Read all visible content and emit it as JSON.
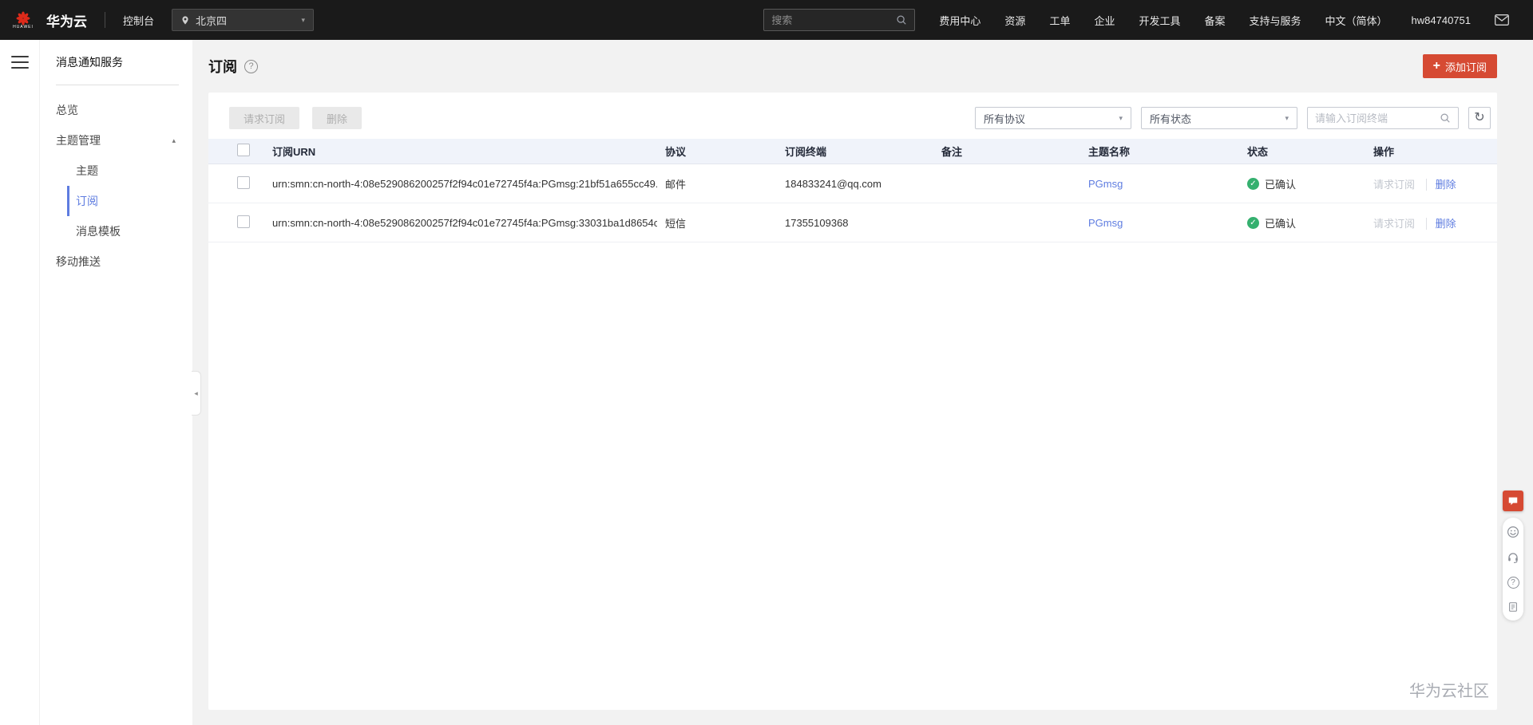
{
  "colors": {
    "accent": "#d64a33",
    "link": "#5e7ce0",
    "success": "#35b06f",
    "topbar_bg": "#1a1a1a"
  },
  "icons": {
    "help": "?",
    "refresh": "↻",
    "caret_down": "▾",
    "caret_up": "▴",
    "collapse": "◂",
    "check": "✓",
    "plus": "+"
  },
  "topbar": {
    "logo_text": "HUAWEI",
    "brand": "华为云",
    "console": "控制台",
    "region": "北京四",
    "search_placeholder": "搜索",
    "nav": [
      "费用中心",
      "资源",
      "工单",
      "企业",
      "开发工具",
      "备案",
      "支持与服务",
      "中文（简体）",
      "hw84740751"
    ]
  },
  "sidebar": {
    "title": "消息通知服务",
    "items": {
      "overview": "总览",
      "topic_management": "主题管理",
      "topics": "主题",
      "subscriptions": "订阅",
      "message_templates": "消息模板",
      "mobile_push": "移动推送"
    }
  },
  "page": {
    "title": "订阅",
    "add_button": "添加订阅"
  },
  "toolbar": {
    "request": "请求订阅",
    "delete": "删除",
    "protocol_filter": "所有协议",
    "status_filter": "所有状态",
    "endpoint_search_placeholder": "请输入订阅终端"
  },
  "table": {
    "headers": [
      "订阅URN",
      "协议",
      "订阅终端",
      "备注",
      "主题名称",
      "状态",
      "操作"
    ],
    "rows": [
      {
        "urn": "urn:smn:cn-north-4:08e529086200257f2f94c01e72745f4a:PGmsg:21bf51a655cc49...",
        "protocol": "邮件",
        "endpoint": "184833241@qq.com",
        "remark": "",
        "topic": "PGmsg",
        "status": "已确认",
        "action_request": "请求订阅",
        "action_delete": "删除"
      },
      {
        "urn": "urn:smn:cn-north-4:08e529086200257f2f94c01e72745f4a:PGmsg:33031ba1d8654c...",
        "protocol": "短信",
        "endpoint": "17355109368",
        "remark": "",
        "topic": "PGmsg",
        "status": "已确认",
        "action_request": "请求订阅",
        "action_delete": "删除"
      }
    ]
  },
  "watermark": "华为云社区"
}
